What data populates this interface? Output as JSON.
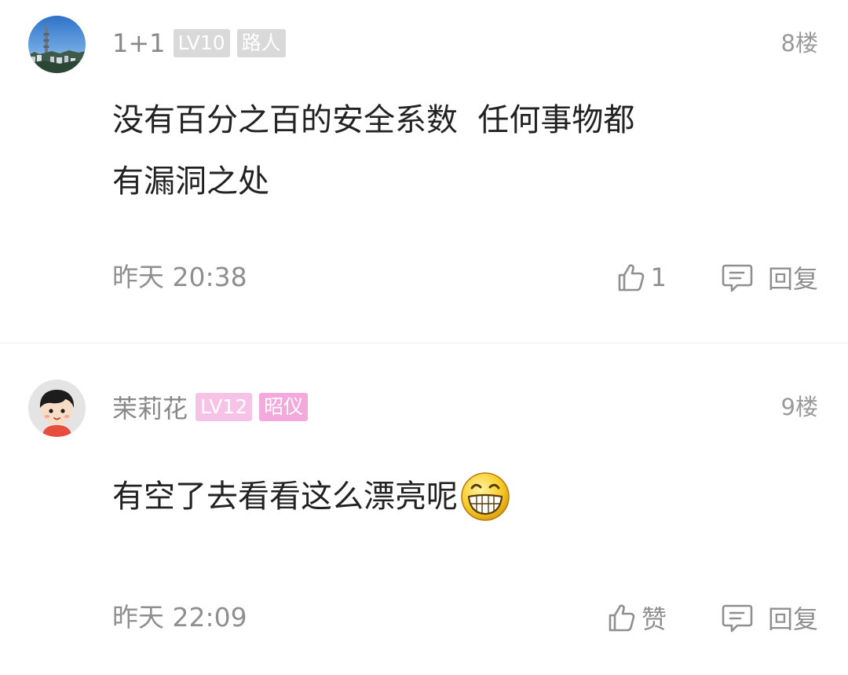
{
  "comments": [
    {
      "username": "1+1",
      "level": "LV10",
      "title": "路人",
      "floor": "8楼",
      "text_line1": "没有百分之百的安全系数  任何事物都",
      "text_line2": "有漏洞之处",
      "time": "昨天 20:38",
      "like_label": "1",
      "reply_label": "回复",
      "avatar_icon": "city-skyline-avatar",
      "badge_color": "#d9d9d9"
    },
    {
      "username": "茉莉花",
      "level": "LV12",
      "title": "昭仪",
      "floor": "9楼",
      "text": "有空了去看看这么漂亮呢",
      "emoji": "grin-emoji",
      "time": "昨天 22:09",
      "like_label": "赞",
      "reply_label": "回复",
      "avatar_icon": "cartoon-kid-avatar",
      "badge_color": "#f4a9dc"
    }
  ],
  "colors": {
    "meta_gray": "#8f8f8f",
    "text_dark": "#222222",
    "divider": "#ececec"
  }
}
